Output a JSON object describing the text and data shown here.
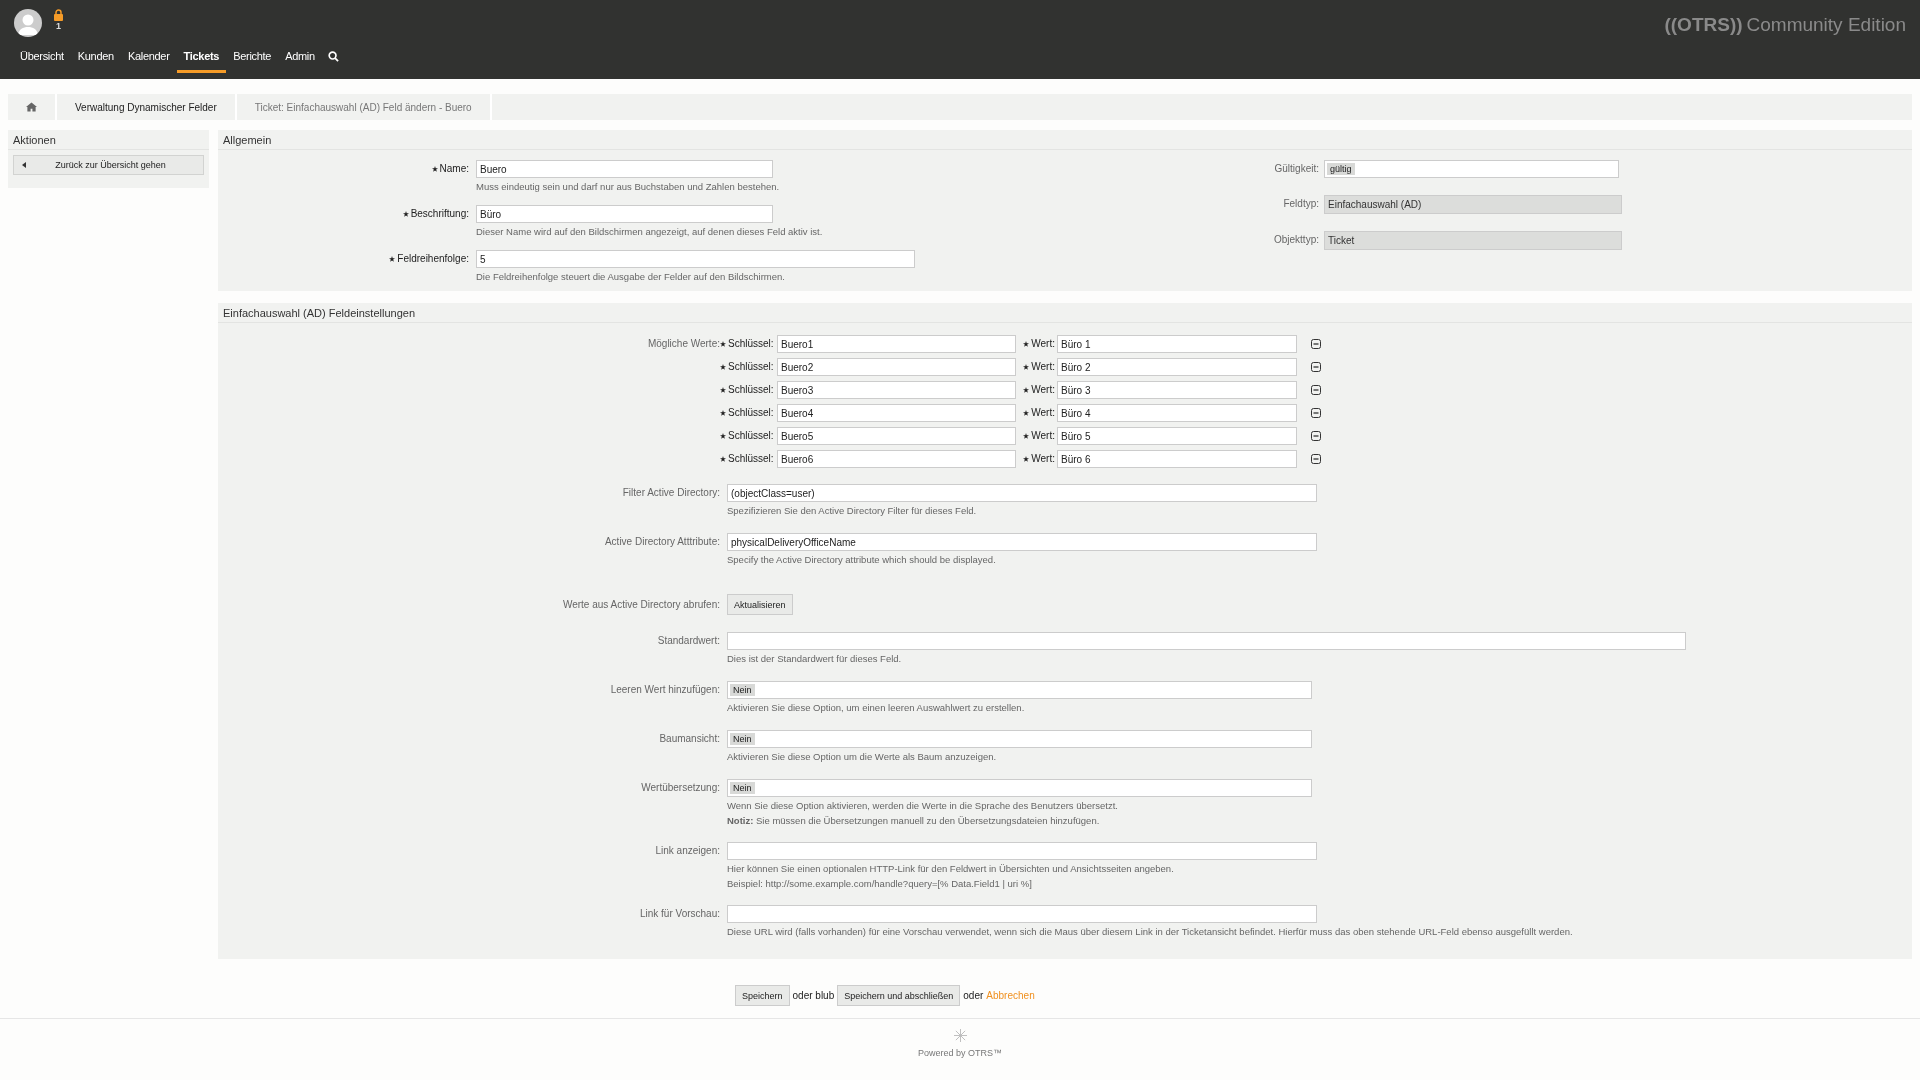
{
  "header": {
    "lock_count": "1",
    "nav": [
      {
        "label": "Übersicht",
        "selected": false
      },
      {
        "label": "Kunden",
        "selected": false
      },
      {
        "label": "Kalender",
        "selected": false
      },
      {
        "label": "Tickets",
        "selected": true
      },
      {
        "label": "Berichte",
        "selected": false
      },
      {
        "label": "Admin",
        "selected": false
      }
    ],
    "logo": "((OTRS))",
    "edition": "Community Edition"
  },
  "breadcrumb": [
    "Verwaltung Dynamischer Felder",
    "Ticket: Einfachauswahl (AD) Feld ändern - Buero"
  ],
  "sidebar": {
    "title": "Aktionen",
    "button": "Zurück zur Übersicht gehen"
  },
  "general": {
    "title": "Allgemein",
    "left": [
      {
        "label": "Name:",
        "required": true,
        "value": "Buero",
        "hint": "Muss eindeutig sein und darf nur aus Buchstaben und Zahlen bestehen."
      },
      {
        "label": "Beschriftung:",
        "required": true,
        "value": "Büro",
        "hint": "Dieser Name wird auf den Bildschirmen angezeigt, auf denen dieses Feld aktiv ist."
      },
      {
        "label": "Feldreihenfolge:",
        "required": true,
        "value": "5",
        "hint": "Die Feldreihenfolge steuert die Ausgabe der Felder auf den Bildschirmen."
      }
    ],
    "right": [
      {
        "label": "Gültigkeit:",
        "kind": "select",
        "value": "gültig"
      },
      {
        "label": "Feldtyp:",
        "kind": "readonly",
        "value": "Einfachauswahl (AD)"
      },
      {
        "label": "Objekttyp:",
        "kind": "readonly",
        "value": "Ticket"
      }
    ]
  },
  "settings": {
    "title": "Einfachauswahl (AD) Feldeinstellungen",
    "possible_values": {
      "label": "Mögliche Werte:",
      "rows": [
        {
          "key_label": "Schlüssel:",
          "key": "Buero1",
          "value_label": "Wert:",
          "value": "Büro 1"
        },
        {
          "key_label": "Schlüssel:",
          "key": "Buero2",
          "value_label": "Wert:",
          "value": "Büro 2"
        },
        {
          "key_label": "Schlüssel:",
          "key": "Buero3",
          "value_label": "Wert:",
          "value": "Büro 3"
        },
        {
          "key_label": "Schlüssel:",
          "key": "Buero4",
          "value_label": "Wert:",
          "value": "Büro 4"
        },
        {
          "key_label": "Schlüssel:",
          "key": "Buero5",
          "value_label": "Wert:",
          "value": "Büro 5"
        },
        {
          "key_label": "Schlüssel:",
          "key": "Buero6",
          "value_label": "Wert:",
          "value": "Büro 6"
        }
      ]
    },
    "fields": [
      {
        "kind": "text",
        "label": "Filter Active Directory:",
        "value": "(objectClass=user)",
        "hints": [
          "Spezifizieren Sie den Active Directory Filter für dieses Feld."
        ]
      },
      {
        "kind": "text",
        "label": "Active Directory Atttribute:",
        "value": "physicalDeliveryOfficeName",
        "hints": [
          "Specify the Active Directory attribute which should be displayed."
        ]
      },
      {
        "kind": "button",
        "label": "Werte aus Active Directory abrufen:",
        "value": "Aktualisieren"
      },
      {
        "kind": "longtext",
        "label": "Standardwert:",
        "hints": [
          "Dies ist der Standardwert für dieses Feld."
        ]
      },
      {
        "kind": "select",
        "label": "Leeren Wert hinzufügen:",
        "value": "Nein",
        "hints": [
          "Aktivieren Sie diese Option, um einen leeren Auswahlwert zu erstellen."
        ]
      },
      {
        "kind": "select",
        "label": "Baumansicht:",
        "value": "Nein",
        "hints": [
          "Aktivieren Sie diese Option um die Werte als Baum anzuzeigen."
        ]
      },
      {
        "kind": "select",
        "label": "Wertübersetzung:",
        "value": "Nein",
        "hints": [
          "Wenn Sie diese Option aktivieren, werden die Werte in die Sprache des Benutzers übersetzt.",
          "**Notiz:** Sie müssen die Übersetzungen manuell zu den Übersetzungsdateien hinzufügen."
        ]
      },
      {
        "kind": "text",
        "label": "Link anzeigen:",
        "hints": [
          "Hier können Sie einen optionalen HTTP-Link für den Feldwert in Übersichten und Ansichtsseiten angeben.",
          "Beispiel: http://some.example.com/handle?query=[% Data.Field1 | uri %]"
        ]
      },
      {
        "kind": "text",
        "label": "Link für Vorschau:",
        "hints": [
          "Diese URL wird (falls vorhanden) für eine Vorschau verwendet, wenn sich die Maus über diesem Link in der Ticketansicht befindet. Hierfür muss das oben stehende URL-Feld ebenso ausgefüllt werden."
        ]
      }
    ]
  },
  "actions": {
    "save": "Speichern",
    "or1": "oder blub",
    "save_close": "Speichern und abschließen",
    "or2": "oder",
    "cancel": "Abbrechen"
  },
  "footer": "Powered by OTRS™"
}
